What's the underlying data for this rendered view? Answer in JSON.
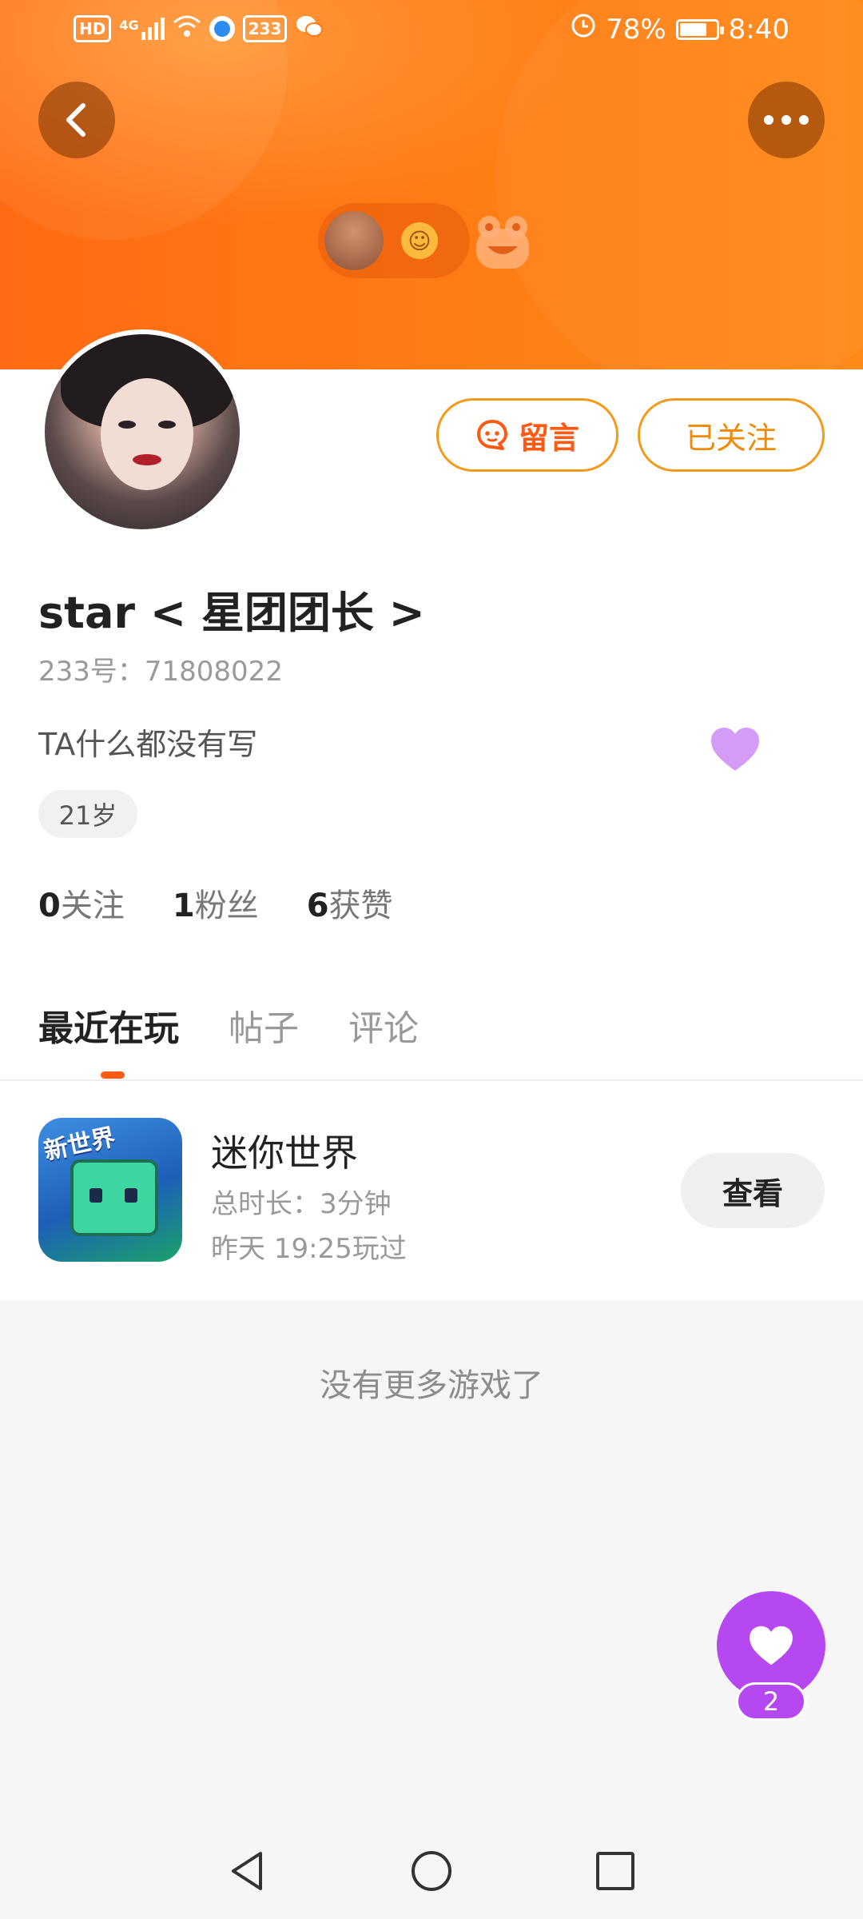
{
  "status_bar": {
    "left_icons": [
      "HD",
      "4G",
      "233"
    ],
    "battery": "78%",
    "battery_level": 0.78,
    "time": "8:40"
  },
  "header": {
    "back_icon": "chevron-left-icon",
    "more_icon": "more-dots-icon"
  },
  "profile": {
    "name": "star < 星团团长 >",
    "uid": "233号：71808022",
    "bio": "TA什么都没有写",
    "age": "21岁",
    "message_button": "留言",
    "follow_button": "已关注",
    "stats": [
      {
        "num": "0",
        "label": "关注"
      },
      {
        "num": "1",
        "label": "粉丝"
      },
      {
        "num": "6",
        "label": "获赞"
      }
    ]
  },
  "tabs": [
    {
      "label": "最近在玩",
      "active": true
    },
    {
      "label": "帖子",
      "active": false
    },
    {
      "label": "评论",
      "active": false
    }
  ],
  "games": [
    {
      "title": "迷你世界",
      "icon_text": "新世界",
      "duration": "总时长：3分钟",
      "last_played": "昨天 19:25玩过",
      "action": "查看"
    }
  ],
  "list_end": "没有更多游戏了",
  "floating_like": {
    "count": "2",
    "color": "#b548f0"
  },
  "colors": {
    "accent": "#ff7a00",
    "header": "#ff7d14",
    "like": "#b548f0"
  }
}
